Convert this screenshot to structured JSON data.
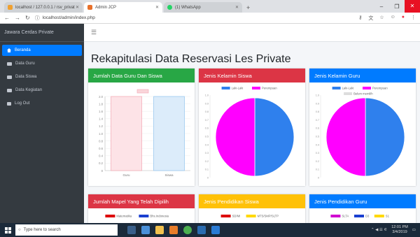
{
  "browser": {
    "tabs": [
      {
        "title": "localhost / 127.0.0.1 / rsv_privat",
        "color": "#f0a030",
        "active": false
      },
      {
        "title": "Admin JCP",
        "color": "#e8702a",
        "active": true
      },
      {
        "title": "(1) WhatsApp",
        "color": "#25d366",
        "active": false
      }
    ],
    "url": "localhost/admin/index.php"
  },
  "sidebar": {
    "brand": "Jawara Cerdas Private",
    "items": [
      {
        "label": "Beranda",
        "active": true
      },
      {
        "label": "Data Guru",
        "active": false
      },
      {
        "label": "Data Siswa",
        "active": false
      },
      {
        "label": "Data Kegiatan",
        "active": false
      },
      {
        "label": "Log Out",
        "active": false
      }
    ]
  },
  "page": {
    "title": "Rekapitulasi Data Reservasi Les Private"
  },
  "colors": {
    "green": "#28a745",
    "red": "#dc3545",
    "blue": "#007bff",
    "yellow": "#ffc107",
    "magenta": "#ff00ff",
    "chartblue": "#2f80ed"
  },
  "cards": [
    {
      "title": "Jumlah Data Guru Dan Siswa",
      "color": "green"
    },
    {
      "title": "Jenis Kelamin Siswa",
      "color": "red"
    },
    {
      "title": "Jenis Kelamin Guru",
      "color": "blue"
    },
    {
      "title": "Jumlah Mapel Yang Telah Dipilih",
      "color": "red"
    },
    {
      "title": "Jenis Pendidikan Siswa",
      "color": "yellow"
    },
    {
      "title": "Jenis Pendidikan Guru",
      "color": "blue"
    }
  ],
  "chart_data": [
    {
      "type": "bar",
      "categories": [
        "Guru",
        "Siswa"
      ],
      "values": [
        2,
        2
      ],
      "ylim": [
        0,
        2.0
      ],
      "yticks": [
        "0",
        "0.2",
        "0.4",
        "0.6",
        "0.8",
        "1.0",
        "1.2",
        "1.4",
        "1.6",
        "1.8",
        "2.0"
      ],
      "legend_position": "top"
    },
    {
      "type": "pie",
      "legend": [
        "Laki-Laki",
        "Perempuan"
      ],
      "values": [
        1,
        1
      ],
      "colors": [
        "#2f80ed",
        "#ff00ff"
      ],
      "yticks": [
        "0",
        "0.1",
        "0.2",
        "0.3",
        "0.4",
        "0.5",
        "0.6",
        "0.7",
        "0.8",
        "0.9",
        "1.0"
      ]
    },
    {
      "type": "pie",
      "legend": [
        "Laki-Laki",
        "Perempuan",
        "Belum memilih"
      ],
      "values": [
        1,
        1,
        0
      ],
      "colors": [
        "#2f80ed",
        "#ff00ff",
        "#dddddd"
      ],
      "yticks": [
        "0",
        "0.1",
        "0.2",
        "0.3",
        "0.4",
        "0.5",
        "0.6",
        "0.7",
        "0.8",
        "0.9",
        "1.0"
      ]
    },
    {
      "type": "legend-only",
      "legend": [
        "Matematika",
        "Bhs.Indonesia"
      ],
      "colors": [
        "#dd0000",
        "#1a3fd0"
      ]
    },
    {
      "type": "legend-only",
      "legend": [
        "SD/MI",
        "MTS/SMP/SLTP"
      ],
      "colors": [
        "#dd0000",
        "#ffd800"
      ]
    },
    {
      "type": "legend-only",
      "legend": [
        "SLTA",
        "D3",
        "S1"
      ],
      "colors": [
        "#d000d0",
        "#1a3fd0",
        "#ffd800"
      ]
    }
  ],
  "taskbar": {
    "search_placeholder": "Type here to search",
    "time": "12:01 PM",
    "date": "3/4/2019"
  }
}
